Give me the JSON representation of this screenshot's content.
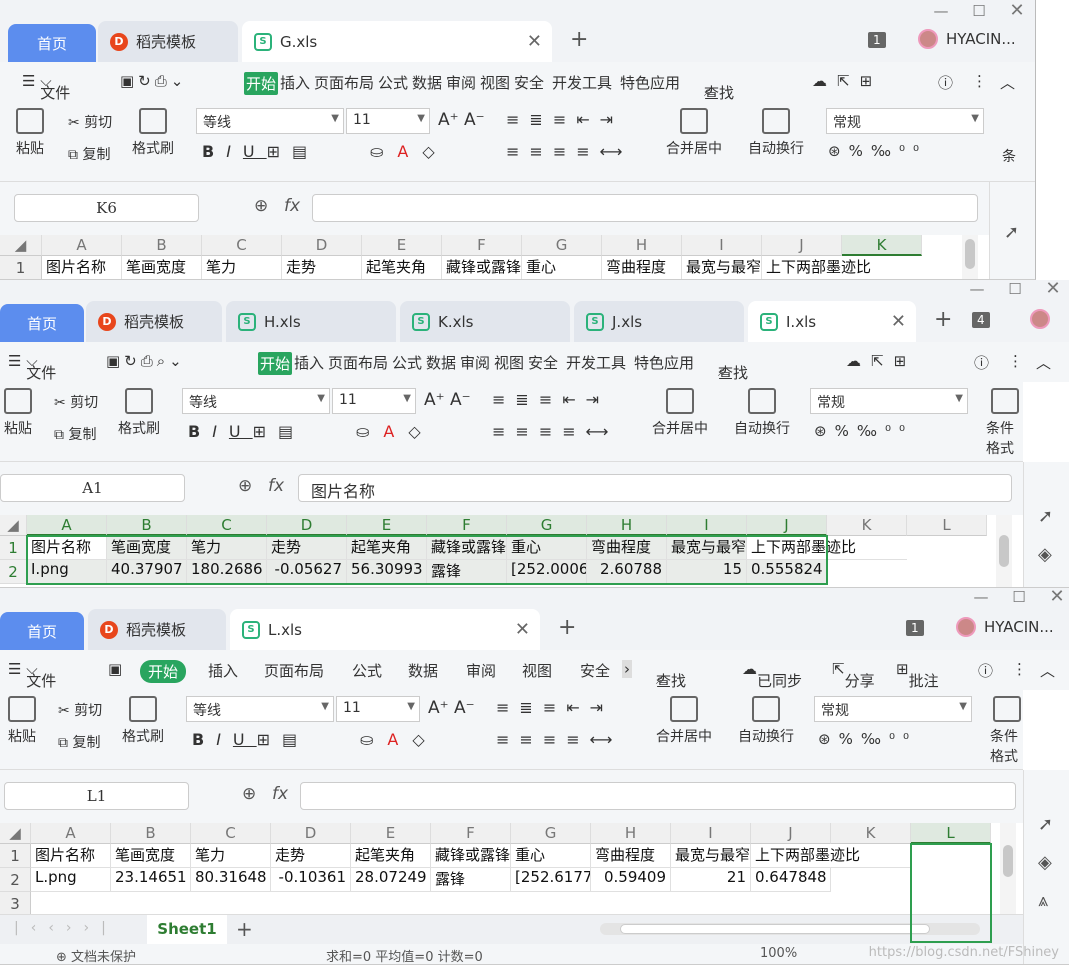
{
  "common": {
    "home_tab": "首页",
    "template_tab": "稻壳模板",
    "file_menu": "文件",
    "start": "开始",
    "insert": "插入",
    "page_layout": "页面布局",
    "formula": "公式",
    "data": "数据",
    "review": "审阅",
    "view": "视图",
    "security": "安全",
    "dev_tools": "开发工具",
    "special": "特色应用",
    "search": "查找",
    "paste": "粘贴",
    "cut": "剪切",
    "copy": "复制",
    "format_painter": "格式刷",
    "font_name": "等线",
    "font_size": "11",
    "merge_center": "合并居中",
    "auto_wrap": "自动换行",
    "number_format": "常规",
    "cond_format": "条件格式",
    "cond_short": "条",
    "user": "HYACIN...",
    "fx": "fx",
    "columns": [
      "A",
      "B",
      "C",
      "D",
      "E",
      "F",
      "G",
      "H",
      "I",
      "J",
      "K",
      "L"
    ],
    "headers": [
      "图片名称",
      "笔画宽度",
      "笔力",
      "走势",
      "起笔夹角",
      "藏锋或露锋",
      "重心",
      "弯曲程度",
      "最宽与最窄",
      "上下两部墨迹比"
    ]
  },
  "window1": {
    "file_tab": "G.xls",
    "tab_count": "1",
    "namebox": "K6",
    "formula": ""
  },
  "window2": {
    "tabs": [
      "H.xls",
      "K.xls",
      "J.xls",
      "I.xls"
    ],
    "tab_count": "4",
    "namebox": "A1",
    "formula": "图片名称",
    "row2": [
      "I.png",
      "40.37907",
      "180.2686",
      "-0.05627",
      "56.30993",
      "露锋",
      "[252.0006",
      "2.60788",
      "15",
      "0.555824"
    ]
  },
  "window3": {
    "file_tab": "L.xls",
    "tab_count": "1",
    "synced": "已同步",
    "share": "分享",
    "comment": "批注",
    "namebox": "L1",
    "formula": "",
    "row2": [
      "L.png",
      "23.14651",
      "80.31648",
      "-0.10361",
      "28.07249",
      "露锋",
      "[252.6177",
      "0.59409",
      "21",
      "0.647848"
    ],
    "sheet": "Sheet1",
    "status_sum": "求和=0 平均值=0 计数=0",
    "zoom": "100%",
    "doc_status": "文档未保护",
    "watermark": "https://blog.csdn.net/FShiney"
  }
}
